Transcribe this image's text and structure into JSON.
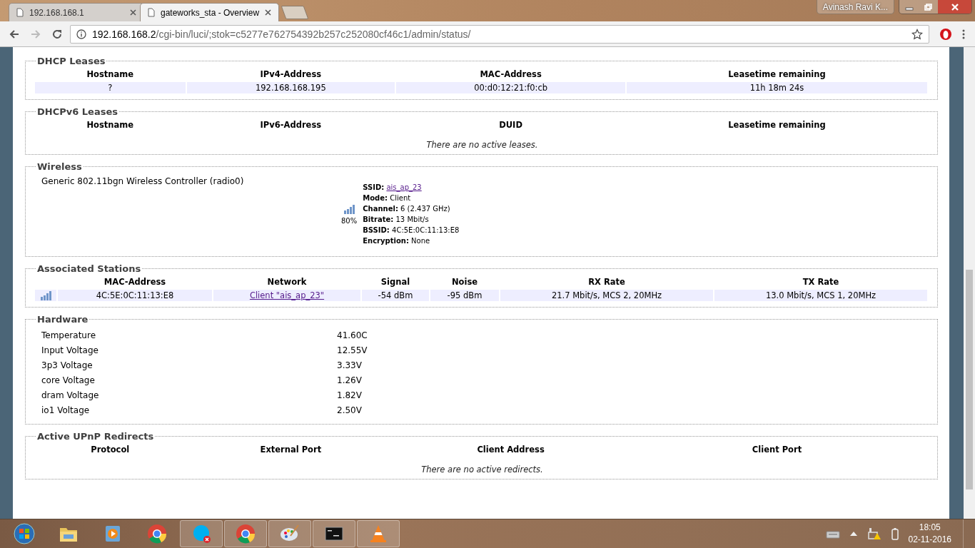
{
  "browser": {
    "tabs": [
      {
        "title": "192.168.168.1",
        "selected": false
      },
      {
        "title": "gateworks_sta - Overview",
        "selected": true
      }
    ],
    "user": "Avinash Ravi K...",
    "url_host": "192.168.168.2",
    "url_path": "/cgi-bin/luci/;stok=c5277e762754392b257c252080cf46c1/admin/status/"
  },
  "sections": [
    {
      "kind": "table",
      "legend": "DHCP Leases",
      "columns": [
        "Hostname",
        "IPv4-Address",
        "MAC-Address",
        "Leasetime remaining"
      ],
      "rows": [
        [
          "?",
          "192.168.168.195",
          "00:d0:12:21:f0:cb",
          "11h 18m 24s"
        ]
      ]
    },
    {
      "kind": "table",
      "legend": "DHCPv6 Leases",
      "columns": [
        "Hostname",
        "IPv6-Address",
        "DUID",
        "Leasetime remaining"
      ],
      "empty_message": "There are no active leases."
    },
    {
      "kind": "wireless",
      "legend": "Wireless",
      "device": "Generic 802.11bgn Wireless Controller (radio0)",
      "quality": "80%",
      "fields": [
        {
          "label": "SSID:",
          "value": "ais_ap_23",
          "link": true
        },
        {
          "label": "Mode:",
          "value": "Client",
          "link": false
        },
        {
          "label": "Channel:",
          "value": "6 (2.437 GHz)",
          "link": false
        },
        {
          "label": "Bitrate:",
          "value": "13 Mbit/s",
          "link": false
        },
        {
          "label": "BSSID:",
          "value": "4C:5E:0C:11:13:E8",
          "link": false
        },
        {
          "label": "Encryption:",
          "value": "None",
          "link": false
        }
      ]
    },
    {
      "kind": "stations",
      "legend": "Associated Stations",
      "columns": [
        "MAC-Address",
        "Network",
        "Signal",
        "Noise",
        "RX Rate",
        "TX Rate"
      ],
      "rows": [
        {
          "mac": "4C:5E:0C:11:13:E8",
          "network": "Client \"ais_ap_23\"",
          "signal": "-54 dBm",
          "noise": "-95 dBm",
          "rx": "21.7 Mbit/s, MCS 2, 20MHz",
          "tx": "13.0 Mbit/s, MCS 1, 20MHz"
        }
      ]
    },
    {
      "kind": "hardware",
      "legend": "Hardware",
      "rows": [
        {
          "label": "Temperature",
          "value": "41.60C"
        },
        {
          "label": "Input Voltage",
          "value": "12.55V"
        },
        {
          "label": "3p3 Voltage",
          "value": "3.33V"
        },
        {
          "label": "core Voltage",
          "value": "1.26V"
        },
        {
          "label": "dram Voltage",
          "value": "1.82V"
        },
        {
          "label": "io1 Voltage",
          "value": "2.50V"
        }
      ]
    },
    {
      "kind": "table",
      "legend": "Active UPnP Redirects",
      "columns": [
        "Protocol",
        "External Port",
        "Client Address",
        "Client Port"
      ],
      "empty_message": "There are no active redirects."
    }
  ],
  "taskbar": {
    "time": "18:05",
    "date": "02-11-2016"
  }
}
